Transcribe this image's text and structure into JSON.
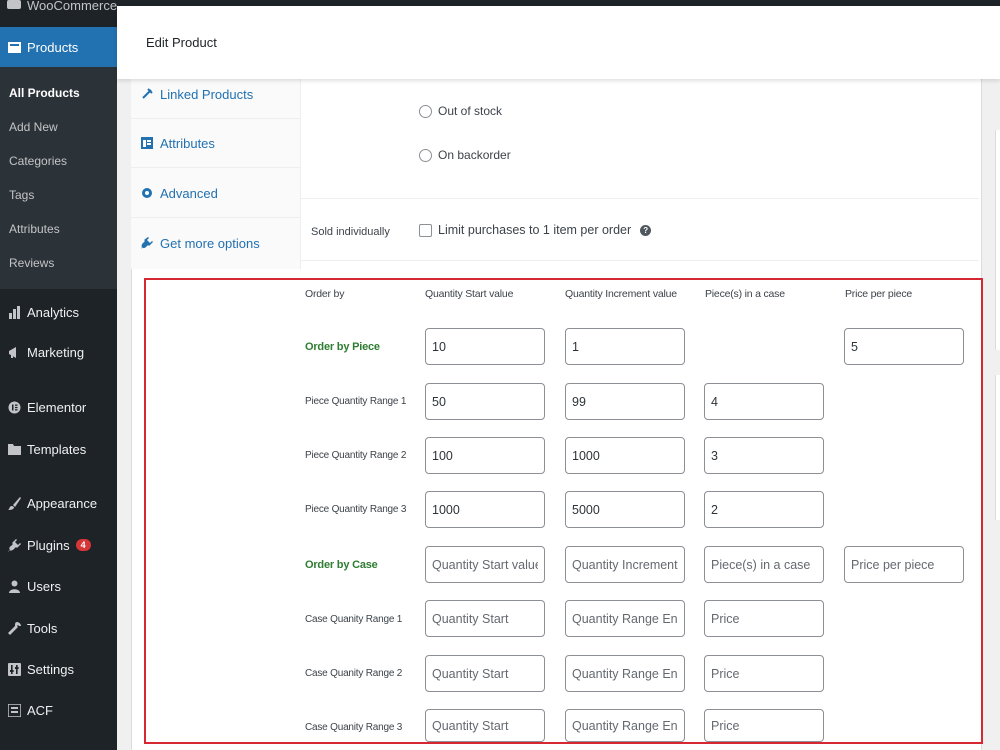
{
  "sidebar": {
    "top_item": "WooCommerce",
    "products": "Products",
    "submenu": [
      {
        "label": "All Products",
        "current": true
      },
      {
        "label": "Add New"
      },
      {
        "label": "Categories"
      },
      {
        "label": "Tags"
      },
      {
        "label": "Attributes"
      },
      {
        "label": "Reviews"
      }
    ],
    "items": [
      {
        "label": "Analytics",
        "icon": "bar-chart-icon"
      },
      {
        "label": "Marketing",
        "icon": "megaphone-icon"
      },
      {
        "label": "Elementor",
        "icon": "elementor-icon"
      },
      {
        "label": "Templates",
        "icon": "folder-icon"
      },
      {
        "label": "Appearance",
        "icon": "paintbrush-icon"
      },
      {
        "label": "Plugins",
        "icon": "plug-icon",
        "badge": "4"
      },
      {
        "label": "Users",
        "icon": "user-icon"
      },
      {
        "label": "Tools",
        "icon": "wrench-icon"
      },
      {
        "label": "Settings",
        "icon": "settings-icon"
      },
      {
        "label": "ACF",
        "icon": "acf-icon"
      }
    ],
    "colors": {
      "background": "#1d2327",
      "active": "#2271b1",
      "submenu_bg": "#2c3338"
    }
  },
  "header": {
    "title": "Edit Product"
  },
  "tabs": [
    {
      "label": "Linked Products",
      "icon": "link-icon"
    },
    {
      "label": "Attributes",
      "icon": "table-icon"
    },
    {
      "label": "Advanced",
      "icon": "gear-icon"
    },
    {
      "label": "Get more options",
      "icon": "plugin-icon"
    }
  ],
  "stock": {
    "options": [
      "Out of stock",
      "On backorder"
    ]
  },
  "sold_individually": {
    "label": "Sold individually",
    "checkbox_label": "Limit purchases to 1 item per order"
  },
  "pricing_table": {
    "highlight_color": "#d62833",
    "headers": [
      "Order by",
      "Quantity Start value",
      "Quantity Increment value",
      "Piece(s) in a case",
      "Price per piece"
    ],
    "rows": [
      {
        "label": "Order by Piece",
        "emphasis": true,
        "fields": [
          {
            "value": "10"
          },
          {
            "value": "1"
          },
          null,
          {
            "value": "5"
          }
        ]
      },
      {
        "label": "Piece Quantity Range 1",
        "fields": [
          {
            "value": "50"
          },
          {
            "value": "99"
          },
          {
            "value": "4"
          },
          null
        ]
      },
      {
        "label": "Piece Quantity Range 2",
        "fields": [
          {
            "value": "100"
          },
          {
            "value": "1000"
          },
          {
            "value": "3"
          },
          null
        ]
      },
      {
        "label": "Piece Quantity Range 3",
        "fields": [
          {
            "value": "1000"
          },
          {
            "value": "5000"
          },
          {
            "value": "2"
          },
          null
        ]
      },
      {
        "label": "Order by Case",
        "emphasis": true,
        "fields": [
          {
            "placeholder": "Quantity Start value"
          },
          {
            "placeholder": "Quantity Increment value"
          },
          {
            "placeholder": "Piece(s) in a case"
          },
          {
            "placeholder": "Price per piece"
          }
        ]
      },
      {
        "label": "Case Quanity Range 1",
        "fields": [
          {
            "placeholder": "Quantity Start"
          },
          {
            "placeholder": "Quantity Range End"
          },
          {
            "placeholder": "Price"
          },
          null
        ]
      },
      {
        "label": "Case Quanity Range 2",
        "fields": [
          {
            "placeholder": "Quantity Start"
          },
          {
            "placeholder": "Quantity Range End"
          },
          {
            "placeholder": "Price"
          },
          null
        ]
      },
      {
        "label": "Case Quanity Range 3",
        "fields": [
          {
            "placeholder": "Quantity Start"
          },
          {
            "placeholder": "Quantity Range End"
          },
          {
            "placeholder": "Price"
          },
          null
        ]
      }
    ]
  }
}
